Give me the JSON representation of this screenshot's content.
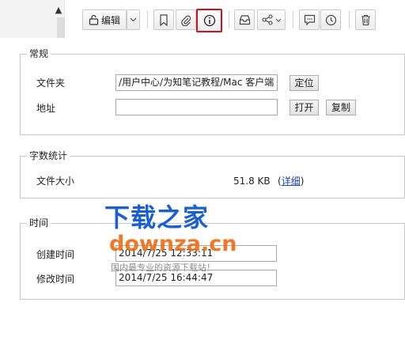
{
  "toolbar": {
    "edit_label": "编辑",
    "highlight_color": "#d0101a"
  },
  "icons": {
    "lock": "lock-icon",
    "bookmark": "bookmark-icon",
    "attachment": "paperclip-icon",
    "info": "info-icon",
    "inbox": "inbox-icon",
    "share": "share-icon",
    "comment": "comment-icon",
    "clock": "clock-icon",
    "trash": "trash-icon"
  },
  "general": {
    "title": "常规",
    "folder_label": "文件夹",
    "folder_value": "/用户中心/为知笔记教程/Mac 客户端",
    "locate_button": "定位",
    "address_label": "地址",
    "address_value": "",
    "open_button": "打开",
    "copy_button": "复制"
  },
  "stats": {
    "title": "字数统计",
    "size_label": "文件大小",
    "size_value": "51.8 KB",
    "details_link": "详细",
    "paren_open": "(",
    "paren_close": ")"
  },
  "time": {
    "title": "时间",
    "created_label": "创建时间",
    "created_value": "2014/7/25 12:33:11",
    "modified_label": "修改时间",
    "modified_value": "2014/7/25 16:44:47"
  },
  "watermark": {
    "main": "下载之家",
    "sub": "downza.cn",
    "tagline": "国内最专业的资源下载站！"
  }
}
